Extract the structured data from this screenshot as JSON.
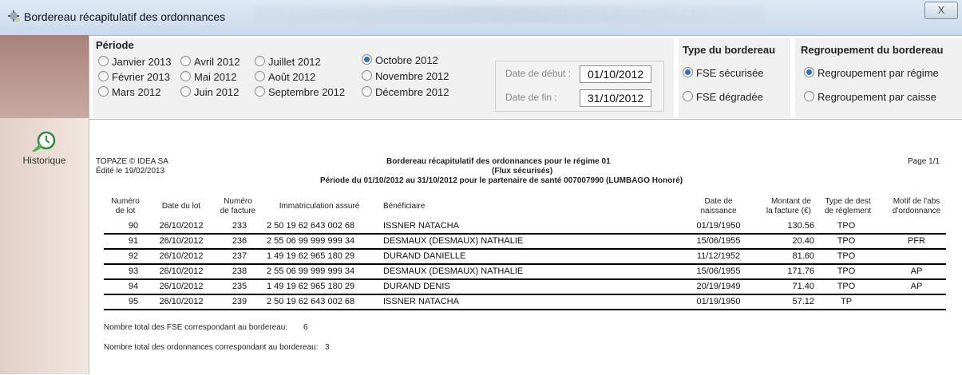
{
  "window": {
    "title": "Bordereau récapitulatif des ordonnances",
    "close_glyph": "X"
  },
  "sidebar": {
    "historique_label": "Historique"
  },
  "periode": {
    "label": "Période",
    "options": [
      {
        "label": "Janvier 2013",
        "selected": false
      },
      {
        "label": "Février 2013",
        "selected": false
      },
      {
        "label": "Mars 2012",
        "selected": false
      },
      {
        "label": "Avril 2012",
        "selected": false
      },
      {
        "label": "Mai 2012",
        "selected": false
      },
      {
        "label": "Juin 2012",
        "selected": false
      },
      {
        "label": "Juillet 2012",
        "selected": false
      },
      {
        "label": "Août 2012",
        "selected": false
      },
      {
        "label": "Septembre 2012",
        "selected": false
      },
      {
        "label": "Octobre 2012",
        "selected": true
      },
      {
        "label": "Novembre 2012",
        "selected": false
      },
      {
        "label": "Décembre 2012",
        "selected": false
      }
    ],
    "date_debut_label": "Date de début :",
    "date_debut_value": "01/10/2012",
    "date_fin_label": "Date de fin :",
    "date_fin_value": "31/10/2012"
  },
  "type_bordereau": {
    "label": "Type du bordereau",
    "options": [
      {
        "label": "FSE sécurisée",
        "selected": true
      },
      {
        "label": "FSE dégradée",
        "selected": false
      }
    ]
  },
  "regroupement": {
    "label": "Regroupement du bordereau",
    "options": [
      {
        "label": "Regroupement par régime",
        "selected": true
      },
      {
        "label": "Regroupement par caisse",
        "selected": false
      }
    ]
  },
  "report": {
    "company": "TOPAZE © IDEA SA",
    "edited": "Édité le  19/02/2013",
    "title": "Bordereau récapitulatif des ordonnances pour le régime 01",
    "subtitle": "(Flux sécurisés)",
    "periode_line": "Période du 01/10/2012 au 31/10/2012 pour le partenaire de santé 007007990 (LUMBAGO Honoré)",
    "page": "Page 1/1",
    "columns": {
      "numero_lot": "Numéro\nde lot",
      "date_lot": "Date du lot",
      "numero_facture": "Numéro\nde facture",
      "immatriculation": "Immatriculation assuré",
      "beneficiaire": "Bénéficiaire",
      "date_naissance": "Date de\nnaissance",
      "montant": "Montant de\nla facture (€)",
      "type_dest": "Type de dest\nde règlement",
      "motif": "Motif de l'abs\nd'ordonnance"
    },
    "rows": [
      {
        "lot": "90",
        "date": "26/10/2012",
        "facture": "233",
        "immat": "2 50 19 62 643 002 68",
        "benef": "ISSNER NATACHA",
        "naissance": "01/19/1950",
        "montant": "130.56",
        "type": "TPO",
        "motif": ""
      },
      {
        "lot": "91",
        "date": "26/10/2012",
        "facture": "236",
        "immat": "2 55 06 99 999 999 34",
        "benef": "DESMAUX (DESMAUX) NATHALIE",
        "naissance": "15/06/1955",
        "montant": "20.40",
        "type": "TPO",
        "motif": "PFR"
      },
      {
        "lot": "92",
        "date": "26/10/2012",
        "facture": "237",
        "immat": "1 49 19 62 965 180 29",
        "benef": "DURAND DANIELLE",
        "naissance": "11/12/1952",
        "montant": "81.60",
        "type": "TPO",
        "motif": ""
      },
      {
        "lot": "93",
        "date": "26/10/2012",
        "facture": "238",
        "immat": "2 55 06 99 999 999 34",
        "benef": "DESMAUX (DESMAUX) NATHALIE",
        "naissance": "15/06/1955",
        "montant": "171.76",
        "type": "TPO",
        "motif": "AP"
      },
      {
        "lot": "94",
        "date": "26/10/2012",
        "facture": "235",
        "immat": "1 49 19 62 965 180 29",
        "benef": "DURAND DENIS",
        "naissance": "20/19/1949",
        "montant": "71.40",
        "type": "TPO",
        "motif": "AP"
      },
      {
        "lot": "95",
        "date": "26/10/2012",
        "facture": "239",
        "immat": "2 50 19 62 643 002 68",
        "benef": "ISSNER NATACHA",
        "naissance": "01/19/1950",
        "montant": "57.12",
        "type": "TP",
        "motif": ""
      }
    ],
    "total_fse_label": "Nombre total des FSE correspondant au bordereau:",
    "total_fse_value": "6",
    "total_ord_label": "Nombre total des ordonnances correspondant au bordereau:",
    "total_ord_value": "3"
  }
}
